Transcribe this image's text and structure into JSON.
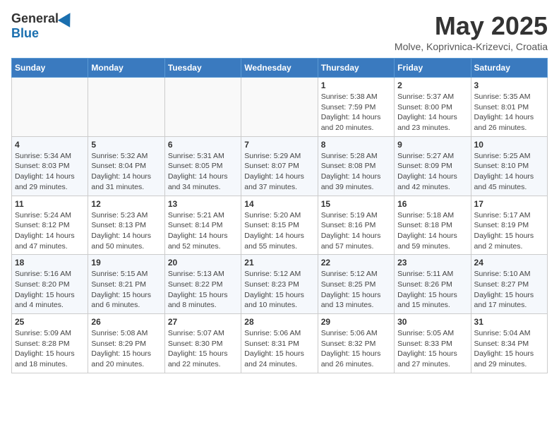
{
  "header": {
    "logo_general": "General",
    "logo_blue": "Blue",
    "month_year": "May 2025",
    "location": "Molve, Koprivnica-Krizevci, Croatia"
  },
  "days_of_week": [
    "Sunday",
    "Monday",
    "Tuesday",
    "Wednesday",
    "Thursday",
    "Friday",
    "Saturday"
  ],
  "weeks": [
    [
      {
        "day": "",
        "info": ""
      },
      {
        "day": "",
        "info": ""
      },
      {
        "day": "",
        "info": ""
      },
      {
        "day": "",
        "info": ""
      },
      {
        "day": "1",
        "info": "Sunrise: 5:38 AM\nSunset: 7:59 PM\nDaylight: 14 hours\nand 20 minutes."
      },
      {
        "day": "2",
        "info": "Sunrise: 5:37 AM\nSunset: 8:00 PM\nDaylight: 14 hours\nand 23 minutes."
      },
      {
        "day": "3",
        "info": "Sunrise: 5:35 AM\nSunset: 8:01 PM\nDaylight: 14 hours\nand 26 minutes."
      }
    ],
    [
      {
        "day": "4",
        "info": "Sunrise: 5:34 AM\nSunset: 8:03 PM\nDaylight: 14 hours\nand 29 minutes."
      },
      {
        "day": "5",
        "info": "Sunrise: 5:32 AM\nSunset: 8:04 PM\nDaylight: 14 hours\nand 31 minutes."
      },
      {
        "day": "6",
        "info": "Sunrise: 5:31 AM\nSunset: 8:05 PM\nDaylight: 14 hours\nand 34 minutes."
      },
      {
        "day": "7",
        "info": "Sunrise: 5:29 AM\nSunset: 8:07 PM\nDaylight: 14 hours\nand 37 minutes."
      },
      {
        "day": "8",
        "info": "Sunrise: 5:28 AM\nSunset: 8:08 PM\nDaylight: 14 hours\nand 39 minutes."
      },
      {
        "day": "9",
        "info": "Sunrise: 5:27 AM\nSunset: 8:09 PM\nDaylight: 14 hours\nand 42 minutes."
      },
      {
        "day": "10",
        "info": "Sunrise: 5:25 AM\nSunset: 8:10 PM\nDaylight: 14 hours\nand 45 minutes."
      }
    ],
    [
      {
        "day": "11",
        "info": "Sunrise: 5:24 AM\nSunset: 8:12 PM\nDaylight: 14 hours\nand 47 minutes."
      },
      {
        "day": "12",
        "info": "Sunrise: 5:23 AM\nSunset: 8:13 PM\nDaylight: 14 hours\nand 50 minutes."
      },
      {
        "day": "13",
        "info": "Sunrise: 5:21 AM\nSunset: 8:14 PM\nDaylight: 14 hours\nand 52 minutes."
      },
      {
        "day": "14",
        "info": "Sunrise: 5:20 AM\nSunset: 8:15 PM\nDaylight: 14 hours\nand 55 minutes."
      },
      {
        "day": "15",
        "info": "Sunrise: 5:19 AM\nSunset: 8:16 PM\nDaylight: 14 hours\nand 57 minutes."
      },
      {
        "day": "16",
        "info": "Sunrise: 5:18 AM\nSunset: 8:18 PM\nDaylight: 14 hours\nand 59 minutes."
      },
      {
        "day": "17",
        "info": "Sunrise: 5:17 AM\nSunset: 8:19 PM\nDaylight: 15 hours\nand 2 minutes."
      }
    ],
    [
      {
        "day": "18",
        "info": "Sunrise: 5:16 AM\nSunset: 8:20 PM\nDaylight: 15 hours\nand 4 minutes."
      },
      {
        "day": "19",
        "info": "Sunrise: 5:15 AM\nSunset: 8:21 PM\nDaylight: 15 hours\nand 6 minutes."
      },
      {
        "day": "20",
        "info": "Sunrise: 5:13 AM\nSunset: 8:22 PM\nDaylight: 15 hours\nand 8 minutes."
      },
      {
        "day": "21",
        "info": "Sunrise: 5:12 AM\nSunset: 8:23 PM\nDaylight: 15 hours\nand 10 minutes."
      },
      {
        "day": "22",
        "info": "Sunrise: 5:12 AM\nSunset: 8:25 PM\nDaylight: 15 hours\nand 13 minutes."
      },
      {
        "day": "23",
        "info": "Sunrise: 5:11 AM\nSunset: 8:26 PM\nDaylight: 15 hours\nand 15 minutes."
      },
      {
        "day": "24",
        "info": "Sunrise: 5:10 AM\nSunset: 8:27 PM\nDaylight: 15 hours\nand 17 minutes."
      }
    ],
    [
      {
        "day": "25",
        "info": "Sunrise: 5:09 AM\nSunset: 8:28 PM\nDaylight: 15 hours\nand 18 minutes."
      },
      {
        "day": "26",
        "info": "Sunrise: 5:08 AM\nSunset: 8:29 PM\nDaylight: 15 hours\nand 20 minutes."
      },
      {
        "day": "27",
        "info": "Sunrise: 5:07 AM\nSunset: 8:30 PM\nDaylight: 15 hours\nand 22 minutes."
      },
      {
        "day": "28",
        "info": "Sunrise: 5:06 AM\nSunset: 8:31 PM\nDaylight: 15 hours\nand 24 minutes."
      },
      {
        "day": "29",
        "info": "Sunrise: 5:06 AM\nSunset: 8:32 PM\nDaylight: 15 hours\nand 26 minutes."
      },
      {
        "day": "30",
        "info": "Sunrise: 5:05 AM\nSunset: 8:33 PM\nDaylight: 15 hours\nand 27 minutes."
      },
      {
        "day": "31",
        "info": "Sunrise: 5:04 AM\nSunset: 8:34 PM\nDaylight: 15 hours\nand 29 minutes."
      }
    ]
  ]
}
